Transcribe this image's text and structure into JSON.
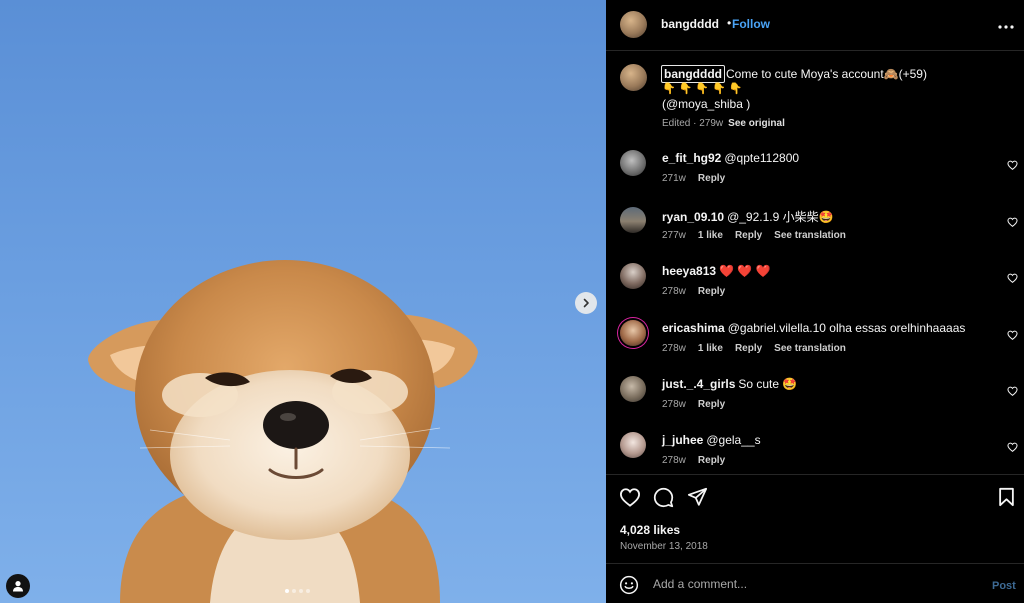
{
  "post": {
    "username": "bangdddd",
    "follow_label": "Follow",
    "separator": "•",
    "caption": {
      "username": "bangdddd",
      "text": "Come to cute Moya's account🙈(+59)",
      "emoji_line": "👇👇👇👇👇",
      "handle_line": "(@moya_shiba )",
      "edited": "Edited · 279w",
      "see_original": "See original"
    },
    "comments": [
      {
        "user": "e_fit_hg92",
        "text": "@qpte112800",
        "time": "271w",
        "likes": "",
        "reply": "Reply",
        "translate": ""
      },
      {
        "user": "ryan_09.10",
        "text": "@_92.1.9 小柴柴🤩",
        "time": "277w",
        "likes": "1 like",
        "reply": "Reply",
        "translate": "See translation"
      },
      {
        "user": "heeya813",
        "text": "❤️ ❤️ ❤️",
        "time": "278w",
        "likes": "",
        "reply": "Reply",
        "translate": ""
      },
      {
        "user": "ericashima",
        "text": "@gabriel.vilella.10 olha essas orelhinhaaaas",
        "time": "278w",
        "likes": "1 like",
        "reply": "Reply",
        "translate": "See translation"
      },
      {
        "user": "just._.4_girls",
        "text": "So cute 🤩",
        "time": "278w",
        "likes": "",
        "reply": "Reply",
        "translate": ""
      },
      {
        "user": "j_juhee",
        "text": "@gela__s",
        "time": "278w",
        "likes": "",
        "reply": "Reply",
        "translate": ""
      }
    ],
    "likes": "4,028 likes",
    "date": "November 13, 2018",
    "comment_placeholder": "Add a comment...",
    "post_label": "Post",
    "carousel": {
      "count": 4,
      "active": 0
    }
  },
  "colors": {
    "accent": "#4aa3f5",
    "background": "#000000",
    "muted": "#a8a8a8"
  }
}
